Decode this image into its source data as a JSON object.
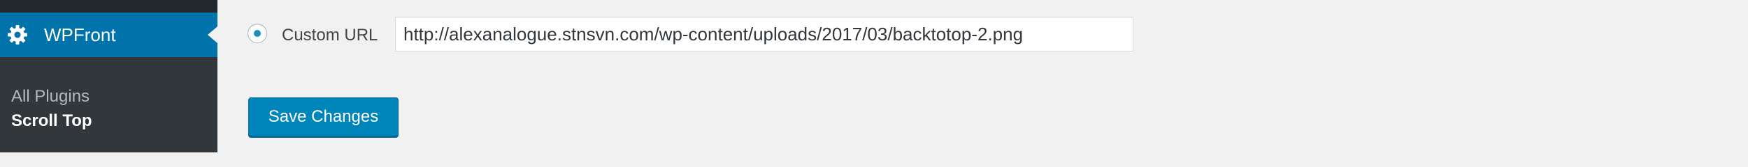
{
  "sidebar": {
    "active_menu": {
      "label": "WPFront",
      "icon": "gear-icon"
    },
    "submenu": [
      {
        "label": "All Plugins",
        "current": false
      },
      {
        "label": "Scroll Top",
        "current": true
      }
    ]
  },
  "settings": {
    "custom_url_option": {
      "label": "Custom URL",
      "selected": true
    },
    "custom_url_value": "http://alexanalogue.stnsvn.com/wp-content/uploads/2017/03/backtotop-2.png"
  },
  "actions": {
    "save_label": "Save Changes"
  },
  "colors": {
    "sidebar_bg": "#32373c",
    "active_menu_bg": "#0073aa",
    "page_bg": "#f1f1f1",
    "primary_button": "#0085ba",
    "radio_dot": "#1e8cbe"
  }
}
